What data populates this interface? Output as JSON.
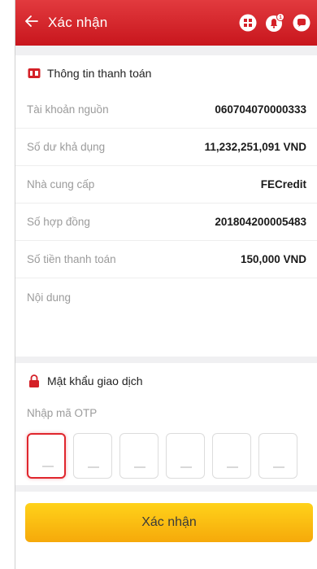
{
  "header": {
    "title": "Xác nhận",
    "back_icon": "arrow-left-icon",
    "icons": [
      "grid-menu-icon",
      "notification-bell-icon",
      "chat-icon"
    ]
  },
  "payment_info": {
    "section_title": "Thông tin thanh toán",
    "rows": [
      {
        "label": "Tài khoản nguồn",
        "value": "060704070000333"
      },
      {
        "label": "Số dư khả dụng",
        "value": "11,232,251,091 VND"
      },
      {
        "label": "Nhà cung cấp",
        "value": "FECredit"
      },
      {
        "label": "Số hợp đồng",
        "value": "201804200005483"
      },
      {
        "label": "Số tiền thanh toán",
        "value": "150,000 VND"
      },
      {
        "label": "Nội dung",
        "value": ""
      }
    ]
  },
  "password": {
    "section_title": "Mật khẩu giao dịch",
    "otp_label": "Nhập mã OTP"
  },
  "footer": {
    "confirm_label": "Xác nhận"
  },
  "colors": {
    "header_red": "#d42027",
    "accent_yellow": "#f9b812",
    "otp_active_border": "#e0262d"
  }
}
